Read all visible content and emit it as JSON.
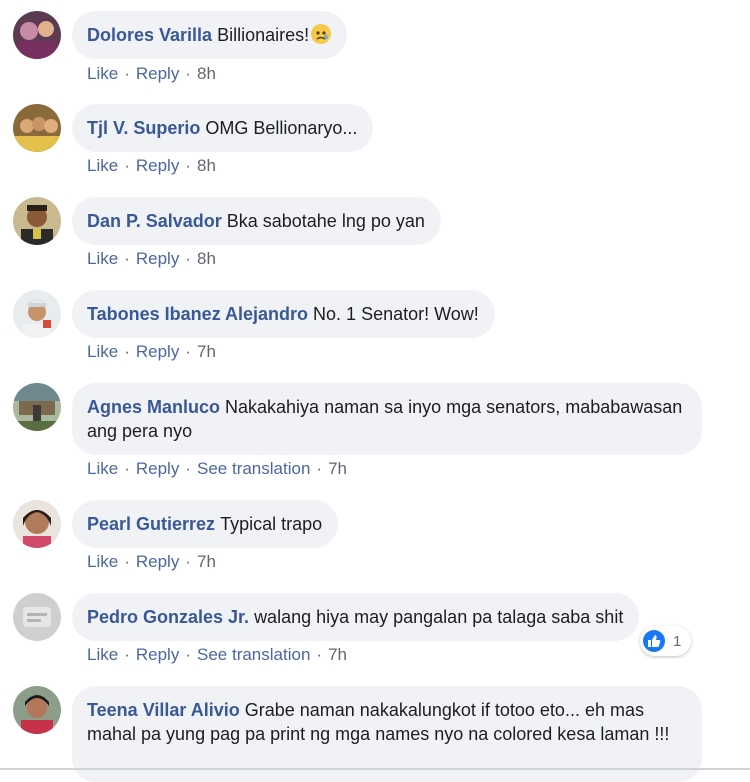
{
  "comments": [
    {
      "name": "Dolores Varilla",
      "text": "Billionaires!",
      "emoji": "tear-emoji",
      "actions": [
        "Like",
        "Reply"
      ],
      "time": "8h"
    },
    {
      "name": "Tjl V. Superio",
      "text": "OMG Bellionaryo...",
      "actions": [
        "Like",
        "Reply"
      ],
      "time": "8h"
    },
    {
      "name": "Dan P. Salvador",
      "text": "Bka sabotahe lng po yan",
      "actions": [
        "Like",
        "Reply"
      ],
      "time": "8h"
    },
    {
      "name": "Tabones Ibanez Alejandro",
      "text": "No. 1 Senator! Wow!",
      "actions": [
        "Like",
        "Reply"
      ],
      "time": "7h"
    },
    {
      "name": "Agnes Manluco",
      "text": "Nakakahiya naman sa inyo mga senators, mababawasan ang pera nyo",
      "actions": [
        "Like",
        "Reply",
        "See translation"
      ],
      "time": "7h"
    },
    {
      "name": "Pearl Gutierrez",
      "text": "Typical trapo",
      "actions": [
        "Like",
        "Reply"
      ],
      "time": "7h"
    },
    {
      "name": "Pedro Gonzales Jr.",
      "text": "walang hiya may pangalan pa talaga saba shit",
      "actions": [
        "Like",
        "Reply",
        "See translation"
      ],
      "time": "7h",
      "reaction_count": "1"
    },
    {
      "name": "Teena Villar Alivio",
      "text": "Grabe naman nakakalungkot if totoo eto... eh mas mahal pa yung pag pa print ng mga names nyo na colored kesa laman !!!"
    }
  ],
  "colors": {
    "name": "#385898",
    "link": "#4b67a1",
    "bubble": "#f0f2f5",
    "like_badge": "#1877f2"
  }
}
